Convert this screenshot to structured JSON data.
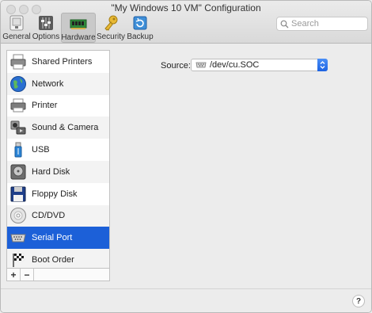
{
  "window": {
    "title": "\"My Windows 10 VM\" Configuration"
  },
  "toolbar": {
    "tabs": [
      {
        "label": "General",
        "icon": "general-icon"
      },
      {
        "label": "Options",
        "icon": "options-icon"
      },
      {
        "label": "Hardware",
        "icon": "hardware-icon",
        "selected": true
      },
      {
        "label": "Security",
        "icon": "security-icon"
      },
      {
        "label": "Backup",
        "icon": "backup-icon"
      }
    ],
    "search": {
      "placeholder": "Search",
      "value": ""
    }
  },
  "sidebar": {
    "items": [
      {
        "label": "Shared Printers",
        "icon": "shared-printers-icon"
      },
      {
        "label": "Network",
        "icon": "network-icon"
      },
      {
        "label": "Printer",
        "icon": "printer-icon"
      },
      {
        "label": "Sound & Camera",
        "icon": "sound-camera-icon"
      },
      {
        "label": "USB",
        "icon": "usb-icon"
      },
      {
        "label": "Hard Disk",
        "icon": "hard-disk-icon"
      },
      {
        "label": "Floppy Disk",
        "icon": "floppy-disk-icon"
      },
      {
        "label": "CD/DVD",
        "icon": "cd-dvd-icon"
      },
      {
        "label": "Serial Port",
        "icon": "serial-port-icon",
        "selected": true
      },
      {
        "label": "Boot Order",
        "icon": "boot-order-icon"
      }
    ],
    "add_label": "+",
    "remove_label": "−"
  },
  "main": {
    "source_label": "Source:",
    "source_value": "/dev/cu.SOC",
    "accent": "#1c60d8"
  },
  "footer": {
    "help_label": "?"
  }
}
